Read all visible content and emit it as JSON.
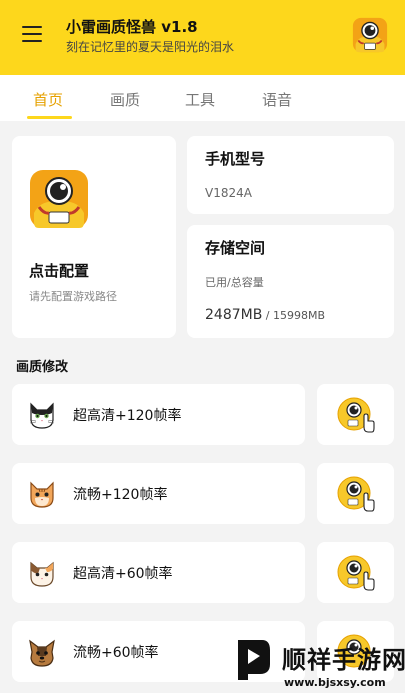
{
  "header": {
    "title": "小雷画质怪兽 v1.8",
    "subtitle": "刻在记忆里的夏天是阳光的泪水",
    "menu_icon": "hamburger-menu-icon",
    "avatar_icon": "one-eyed-monster-avatar",
    "background_color": "#fdd71c"
  },
  "tabs": {
    "items": [
      {
        "label": "首页",
        "active": true
      },
      {
        "label": "画质",
        "active": false
      },
      {
        "label": "工具",
        "active": false
      },
      {
        "label": "语音",
        "active": false
      }
    ],
    "active_color": "#e6a100"
  },
  "config_card": {
    "title": "点击配置",
    "subtitle": "请先配置游戏路径",
    "logo_icon": "one-eyed-monster-logo"
  },
  "phone_card": {
    "title": "手机型号",
    "value": "V1824A"
  },
  "storage_card": {
    "title": "存储空间",
    "label": "已用/总容量",
    "used": "2487MB",
    "total": " / 15998MB"
  },
  "quality_section": {
    "title": "画质修改",
    "modes": [
      {
        "label": "超高清+120帧率",
        "icon": "black-white-cat-icon"
      },
      {
        "label": "流畅+120帧率",
        "icon": "orange-cat-icon"
      },
      {
        "label": "超高清+60帧率",
        "icon": "calico-cat-icon"
      },
      {
        "label": "流畅+60帧率",
        "icon": "yorkie-dog-icon"
      }
    ],
    "apply_icon": "monster-tap-hand-icon"
  },
  "watermark": {
    "brand": "顺祥手游网",
    "url": "www.bjsxsy.com"
  }
}
